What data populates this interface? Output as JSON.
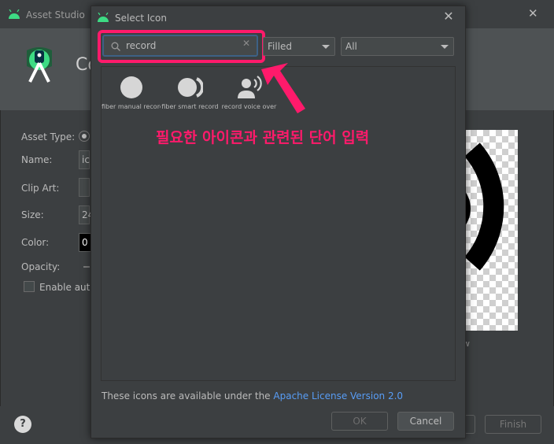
{
  "background": {
    "title": "Asset Studio",
    "header_text": "Co",
    "labels": {
      "asset_type": "Asset Type:",
      "name": "Name:",
      "clip_art": "Clip Art:",
      "size": "Size:",
      "color": "Color:",
      "opacity": "Opacity:",
      "enable_auto": "Enable auto"
    },
    "name_value": "ic",
    "size_value": "24",
    "color_value": "0",
    "preview_tail": "w",
    "help": "?",
    "finish": "Finish"
  },
  "dialog": {
    "title": "Select Icon",
    "search": {
      "value": "record",
      "placeholder": ""
    },
    "style_select": "Filled",
    "category_select": "All",
    "icons": [
      {
        "label": "fiber manual record",
        "icon": "fiber-manual-record-icon"
      },
      {
        "label": "fiber smart record",
        "icon": "fiber-smart-record-icon"
      },
      {
        "label": "record voice over",
        "icon": "record-voice-over-icon"
      }
    ],
    "annotation": "필요한 아이콘과 관련된 단어 입력",
    "license_prefix": "These icons are available under the ",
    "license_link": "Apache License Version 2.0",
    "ok": "OK",
    "cancel": "Cancel"
  },
  "colors": {
    "highlight": "#ff1a6b",
    "link": "#589df6",
    "android_green": "#3ddc84"
  }
}
